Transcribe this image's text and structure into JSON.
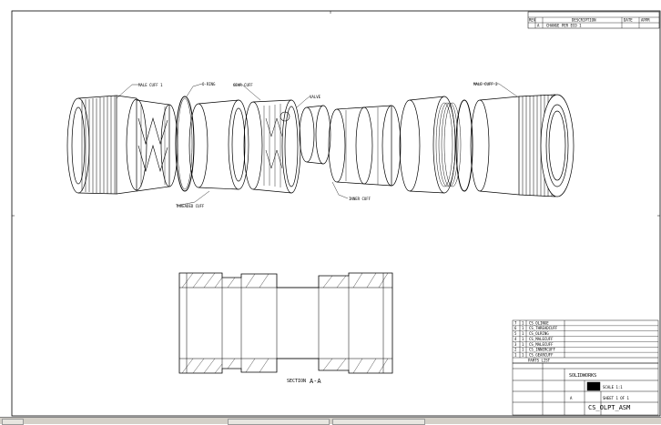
{
  "callouts": {
    "male_cuff_1": "MALE CUFF 1",
    "o_ring": "O-RING",
    "gear_cuff": "GEAR CUFF",
    "valve": "VALVE",
    "male_cuff_2": "MALE CUFF 2",
    "threaded_cuff": "THREADED CUFF",
    "inner_cuff": "INNER CUFF"
  },
  "section": {
    "label": "SECTION",
    "id": "A-A"
  },
  "revision_block": {
    "header_rev": "REV",
    "header_desc": "DESCRIPTION",
    "header_date": "DATE",
    "header_appr": "APPR",
    "row_rev": "A",
    "row_desc": "CHANGE PER ECO 1"
  },
  "parts_list": {
    "title": "PARTS LIST",
    "rows": [
      {
        "item": "7",
        "qty": "1",
        "part": "CS_OLINGE"
      },
      {
        "item": "6",
        "qty": "1",
        "part": "CS_THREADCUFF"
      },
      {
        "item": "5",
        "qty": "1",
        "part": "CS_OLRING"
      },
      {
        "item": "4",
        "qty": "1",
        "part": "CS_MALECUFF"
      },
      {
        "item": "3",
        "qty": "1",
        "part": "CS_MALECUFF"
      },
      {
        "item": "2",
        "qty": "1",
        "part": "CS_INNERCUFF"
      },
      {
        "item": "1",
        "qty": "1",
        "part": "CS_GEARCUFF"
      }
    ]
  },
  "title_block": {
    "company": "SOLIDWORKS",
    "drawing_number": "CS_OLPT_ASM",
    "size": "A",
    "scale": "SCALE 1:1",
    "sheet": "SHEET 1 OF 1"
  }
}
